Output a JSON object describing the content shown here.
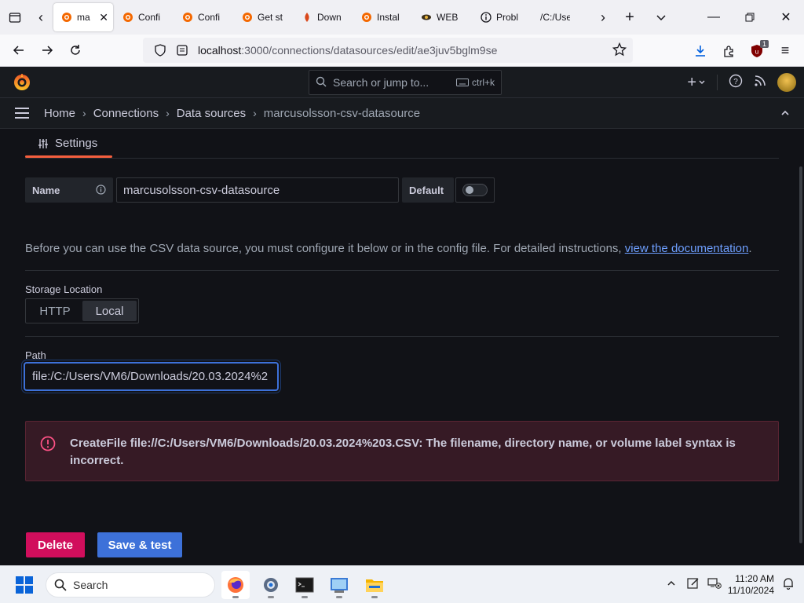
{
  "browser": {
    "tabs": [
      {
        "label": "ma",
        "favicon": "grafana-icon",
        "active": true
      },
      {
        "label": "Confi",
        "favicon": "grafana-icon"
      },
      {
        "label": "Confi",
        "favicon": "grafana-icon"
      },
      {
        "label": "Get st",
        "favicon": "grafana-icon"
      },
      {
        "label": "Down",
        "favicon": "download-page-icon"
      },
      {
        "label": "Instal",
        "favicon": "grafana-icon"
      },
      {
        "label": "WEB",
        "favicon": "web-icon"
      },
      {
        "label": "Probl",
        "favicon": "info-icon"
      },
      {
        "label": "/C:/Use",
        "favicon": "none"
      }
    ],
    "url": {
      "host": "localhost",
      "rest": ":3000/connections/datasources/edit/ae3juv5bglm9se"
    },
    "extension_badge": "1"
  },
  "grafana": {
    "search_placeholder": "Search or jump to...",
    "search_shortcut": "ctrl+k",
    "breadcrumbs": [
      "Home",
      "Connections",
      "Data sources",
      "marcusolsson-csv-datasource"
    ],
    "settings_tab": "Settings",
    "name_label": "Name",
    "name_value": "marcusolsson-csv-datasource",
    "default_label": "Default",
    "default_on": false,
    "intro_text": "Before you can use the CSV data source, you must configure it below or in the config file. For detailed instructions, ",
    "intro_link": "view the documentation",
    "intro_end": ".",
    "storage_label": "Storage Location",
    "storage_options": [
      "HTTP",
      "Local"
    ],
    "storage_selected": "Local",
    "path_label": "Path",
    "path_value": "file:/C:/Users/VM6/Downloads/20.03.2024%2",
    "error_text": "CreateFile file://C:/Users/VM6/Downloads/20.03.2024%203.CSV: The filename, directory name, or volume label syntax is incorrect.",
    "delete_label": "Delete",
    "save_label": "Save & test"
  },
  "taskbar": {
    "search_label": "Search",
    "time": "11:20 AM",
    "date": "11/10/2024"
  },
  "colors": {
    "grafana_orange": "#f55f3e",
    "primary": "#3d71d9",
    "destructive": "#d10e5c",
    "error_bg": "#361a25"
  }
}
